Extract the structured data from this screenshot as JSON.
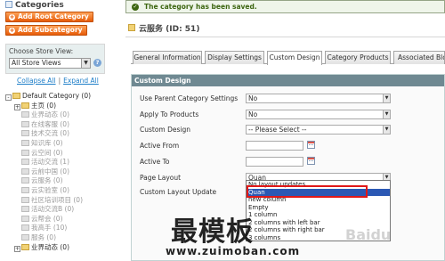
{
  "sidebar": {
    "title": "Categories",
    "add_root_label": "Add Root Category",
    "add_sub_label": "Add Subcategory",
    "store_view_label": "Choose Store View:",
    "store_view_value": "All Store Views",
    "collapse_all": "Collapse All",
    "separator": "|",
    "expand_all": "Expand All",
    "tree": [
      {
        "label": "Default Category (0)",
        "expander": "-"
      },
      {
        "label": "主页 (0)",
        "expander": "+"
      },
      {
        "label": "业界动态 (0)",
        "expander": ""
      },
      {
        "label": "在线客服 (0)",
        "expander": ""
      },
      {
        "label": "技术交流 (0)",
        "expander": ""
      },
      {
        "label": "知识库 (0)",
        "expander": ""
      },
      {
        "label": "云空间 (0)",
        "expander": ""
      },
      {
        "label": "活动交流 (1)",
        "expander": ""
      },
      {
        "label": "云前中国 (0)",
        "expander": ""
      },
      {
        "label": "云服务 (0)",
        "expander": ""
      },
      {
        "label": "云实验室 (0)",
        "expander": ""
      },
      {
        "label": "社区培训项目 (0)",
        "expander": ""
      },
      {
        "label": "活动交流B (0)",
        "expander": ""
      },
      {
        "label": "云帮会 (0)",
        "expander": ""
      },
      {
        "label": "我高手 (10)",
        "expander": ""
      },
      {
        "label": "服务 (0)",
        "expander": ""
      },
      {
        "label": "业界动态 (0)",
        "expander": "+"
      }
    ]
  },
  "main": {
    "success_message": "The category has been saved.",
    "page_title": "云服务 (ID: 51)",
    "tabs": [
      {
        "label": "General Information",
        "active": false
      },
      {
        "label": "Display Settings",
        "active": false
      },
      {
        "label": "Custom Design",
        "active": true
      },
      {
        "label": "Category Products",
        "active": false
      },
      {
        "label": "Associated Blog",
        "active": false
      }
    ],
    "fieldset_title": "Custom Design",
    "fields": {
      "use_parent_label": "Use Parent Category Settings",
      "use_parent_value": "No",
      "apply_products_label": "Apply To Products",
      "apply_products_value": "No",
      "custom_design_label": "Custom Design",
      "custom_design_value": "-- Please Select --",
      "active_from_label": "Active From",
      "active_to_label": "Active To",
      "page_layout_label": "Page Layout",
      "page_layout_value": "Quan",
      "custom_layout_update_label": "Custom Layout Update"
    },
    "page_layout_options": [
      {
        "label": "No layout updates",
        "selected": false
      },
      {
        "label": "Quan",
        "selected": true
      },
      {
        "label": "new column",
        "selected": false
      },
      {
        "label": "Empty",
        "selected": false
      },
      {
        "label": "1 column",
        "selected": false
      },
      {
        "label": "2 columns with left bar",
        "selected": false
      },
      {
        "label": "2 columns with right bar",
        "selected": false
      },
      {
        "label": "3 columns",
        "selected": false
      }
    ]
  },
  "watermark": {
    "chinese": "最模板",
    "url": "www.zuimoban.com",
    "baidu": "Baidu"
  },
  "colors": {
    "orange_button": "#e75b08",
    "fieldset_header": "#6f8992",
    "selected_option": "#2b58b4",
    "highlight_frame": "#e01818",
    "success_text": "#3d6611"
  }
}
